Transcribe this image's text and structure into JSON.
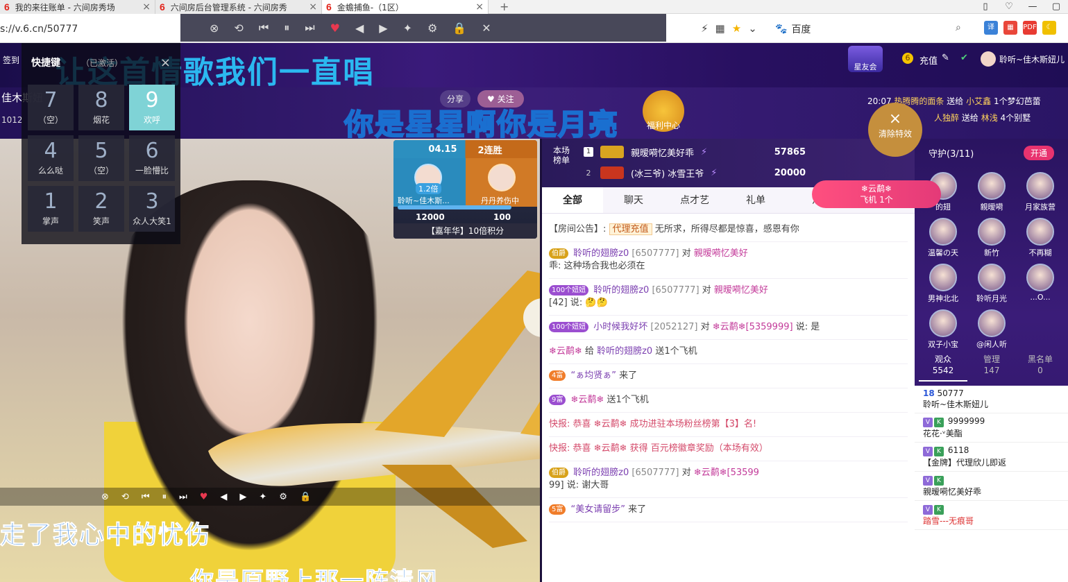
{
  "browser": {
    "tabs": [
      {
        "title": "我的来往账单 - 六间房秀场",
        "close": "×"
      },
      {
        "title": "六间房后台管理系统 - 六间房秀",
        "close": "×"
      },
      {
        "title": "金蟾捕鱼-（1区）",
        "close": "×"
      }
    ],
    "newtab": "+",
    "url": "s://v.6.cn/50777",
    "search_engine": "百度",
    "win_controls": [
      "▯",
      "♡",
      "—",
      "▢"
    ]
  },
  "media_toolbar": {
    "icons": [
      "⊗",
      "⟲",
      "⏮",
      "⏸",
      "⏭",
      "♥",
      "◀",
      "▶",
      "✦",
      "⚙",
      "🔒",
      "✕"
    ]
  },
  "site": {
    "signin": "签到",
    "brand_badge": "星友会",
    "recharge": "充值",
    "user": "聆听~佳木斯妞儿",
    "anchor_name": "佳木斯妞",
    "room_id_text": "1012",
    "share": "分享",
    "follow": "关注",
    "welfare": "福利中心"
  },
  "lyrics": {
    "line1": "让这首情歌我们一直唱",
    "line2": "你是星星啊你是月亮",
    "line3": "走了我心中的忧伤",
    "line4": "你是原野上那一阵清风"
  },
  "shortcut_panel": {
    "title": "快捷键",
    "status": "（已激活）",
    "close": "×",
    "keys": [
      {
        "num": "7",
        "label": "（空）"
      },
      {
        "num": "8",
        "label": "烟花"
      },
      {
        "num": "9",
        "label": "欢呼"
      },
      {
        "num": "4",
        "label": "么么哒"
      },
      {
        "num": "5",
        "label": "（空）"
      },
      {
        "num": "6",
        "label": "一脸懵比"
      },
      {
        "num": "1",
        "label": "掌声"
      },
      {
        "num": "2",
        "label": "笑声"
      },
      {
        "num": "3",
        "label": "众人大笑1"
      }
    ]
  },
  "pk": {
    "date": "04.15",
    "streak": "2连胜",
    "multiplier": "1.2倍",
    "left_name": "聆听~佳木斯...",
    "right_name": "丹丹养伤中",
    "left_score": "12000",
    "right_score": "100",
    "footer": "【嘉年华】10倍积分"
  },
  "rank": {
    "label": "本场榜单",
    "rows": [
      {
        "num": "1",
        "name": "親暧嗬忆美好乖",
        "value": "57865"
      },
      {
        "num": "2",
        "name": "(冰三爷) 冰雪王爷",
        "value": "20000"
      }
    ]
  },
  "feed": [
    {
      "time": "20:07",
      "from": "热腾腾的面条",
      "verb": "送给",
      "to": "小艾鑫",
      "gift": "1个梦幻芭蕾"
    },
    {
      "time": "",
      "from": "人独醉",
      "verb": "送给",
      "to": "林浅",
      "gift": "4个别墅"
    }
  ],
  "clear_fx": {
    "x": "×",
    "label": "清除特效"
  },
  "plane_btn": {
    "name": "❄云鹬❄",
    "text": "飞机 1个"
  },
  "chat": {
    "tabs": [
      "全部",
      "聊天",
      "点才艺",
      "礼单",
      "活"
    ],
    "notice_label": "【房间公告】:",
    "notice_tag": "代理充值",
    "notice_text": "无所求，所得尽都是惊喜，感恩有你",
    "messages": [
      {
        "badge": "伯爵",
        "user": "聆听的翅膀z0",
        "id": "[6507777]",
        "to": "对",
        "target": "親暧嗬忆美好",
        "text": "乖: 这种场合我也必须在"
      },
      {
        "badge": "100个妞妞",
        "user": "聆听的翅膀z0",
        "id": "[6507777]",
        "to": "对",
        "target": "親暧嗬忆美好",
        "text": "[42] 说: 🤔🤔"
      },
      {
        "badge": "100个妞妞",
        "user": "小时候我好坏",
        "id": "[2052127]",
        "to": "对",
        "target": "❄云鹬❄[5359999]",
        "text": "说: 是"
      },
      {
        "badge": "",
        "user": "❄云鹬❄",
        "id": "",
        "to": "给",
        "target": "聆听的翅膀z0",
        "text": "送1个飞机"
      },
      {
        "badge": "4富",
        "user": "“ぁ均贤ぁ”",
        "id": "",
        "to": "",
        "target": "",
        "text": "来了"
      },
      {
        "badge": "9富",
        "user": "❄云鹬❄",
        "id": "",
        "to": "",
        "target": "",
        "text": "送1个飞机"
      },
      {
        "badge": "",
        "user": "快报: 恭喜 ❄云鹬❄",
        "id": "",
        "to": "",
        "target": "",
        "text": "成功进驻本场粉丝榜第【3】名!"
      },
      {
        "badge": "",
        "user": "快报: 恭喜 ❄云鹬❄",
        "id": "",
        "to": "",
        "target": "",
        "text": "获得 百元榜徽章奖励（本场有效）"
      },
      {
        "badge": "伯爵",
        "user": "聆听的翅膀z0",
        "id": "[6507777]",
        "to": "对",
        "target": "❄云鹬❄[53599",
        "text": "99] 说: 谢大哥"
      },
      {
        "badge": "5富",
        "user": "“美女请留步”",
        "id": "",
        "to": "",
        "target": "",
        "text": "来了"
      }
    ]
  },
  "guard": {
    "title": "守护(3/11)",
    "open": "开通",
    "members": [
      "的翅",
      "親暧嗬",
      "月家族营",
      "温馨の天",
      "新竹",
      "不再糊",
      "男神北北",
      "聆听月光",
      "...O...",
      "双子小宝",
      "@闲人听"
    ]
  },
  "audience": {
    "tabs": [
      {
        "label": "观众",
        "count": "5542"
      },
      {
        "label": "管理",
        "count": "147"
      },
      {
        "label": "黑名单",
        "count": "0"
      }
    ],
    "list": [
      {
        "level": "18",
        "name": "50777",
        "sub": "聆听~佳木斯妞儿"
      },
      {
        "level": "",
        "name": "9999999",
        "sub": "花花·ᵛ美酯"
      },
      {
        "level": "",
        "name": "6118",
        "sub": "【金牌】代理欣儿即返"
      },
      {
        "level": "",
        "name": "",
        "sub": "親暧嗬忆美好乖"
      },
      {
        "level": "",
        "name": "",
        "sub": "踏雪---无痕哥"
      }
    ]
  }
}
